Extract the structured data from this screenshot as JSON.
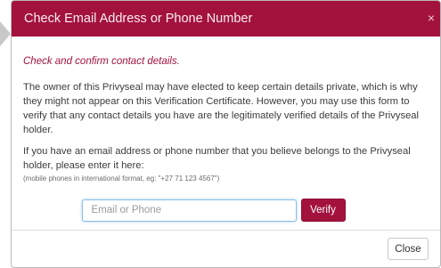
{
  "modal": {
    "title": "Check Email Address or Phone Number",
    "close_icon": "×",
    "subtitle": "Check and confirm contact details.",
    "paragraph1": "The owner of this Privyseal may have elected to keep certain details private, which is why they might not appear on this Verification Certificate. However, you may use this form to verify that any contact details you have are the legitimately verified details of the Privyseal holder.",
    "paragraph2": "If you have an email address or phone number that you believe belongs to the Privyseal holder, please enter it here:",
    "hint": "(mobile phones in international format, eg: \"+27 71 123 4567\")",
    "input": {
      "placeholder": "Email or Phone",
      "value": ""
    },
    "verify_label": "Verify",
    "close_label": "Close"
  },
  "colors": {
    "brand": "#a3123d",
    "header_text": "#ffffff",
    "focus_border": "#8fbfe6"
  },
  "icons": {
    "header_close": "close-icon",
    "pointer": "pointer-triangle-icon"
  }
}
